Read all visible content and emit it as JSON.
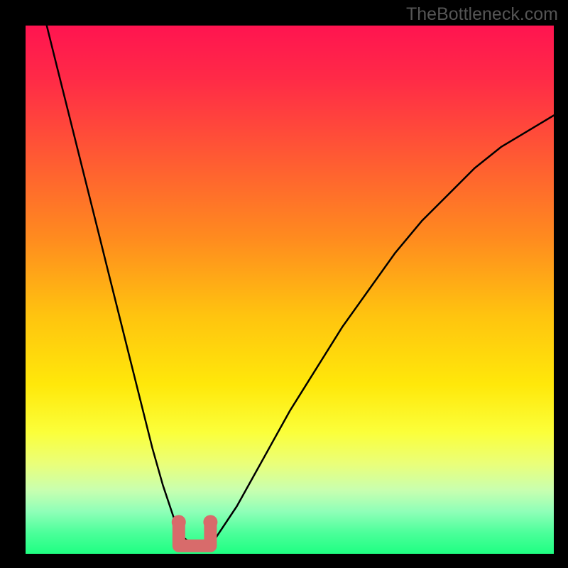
{
  "watermark": {
    "text": "TheBottleneck.com"
  },
  "colors": {
    "frame": "#000000",
    "curve": "#000000",
    "marker": "#d86b6b",
    "gradient_stops": [
      {
        "offset": 0.0,
        "color": "#ff1450"
      },
      {
        "offset": 0.1,
        "color": "#ff2a47"
      },
      {
        "offset": 0.25,
        "color": "#ff5a33"
      },
      {
        "offset": 0.4,
        "color": "#ff8a1f"
      },
      {
        "offset": 0.55,
        "color": "#ffc40f"
      },
      {
        "offset": 0.68,
        "color": "#ffe80a"
      },
      {
        "offset": 0.77,
        "color": "#fbff3a"
      },
      {
        "offset": 0.83,
        "color": "#eaff7a"
      },
      {
        "offset": 0.88,
        "color": "#c8ffb0"
      },
      {
        "offset": 0.92,
        "color": "#8fffb8"
      },
      {
        "offset": 0.96,
        "color": "#4cff9a"
      },
      {
        "offset": 1.0,
        "color": "#1fff82"
      }
    ]
  },
  "chart_data": {
    "type": "line",
    "title": "",
    "xlabel": "",
    "ylabel": "",
    "x_range": [
      0,
      100
    ],
    "y_range": [
      0,
      100
    ],
    "ylim": [
      0,
      100
    ],
    "notes": "V-shaped bottleneck curve with flat minimum region near x≈29–35; highlighted salmon markers at trough edges.",
    "series": [
      {
        "name": "bottleneck-curve",
        "x": [
          4,
          6,
          8,
          10,
          12,
          14,
          16,
          18,
          20,
          22,
          24,
          26,
          28,
          30,
          32,
          34,
          36,
          40,
          45,
          50,
          55,
          60,
          65,
          70,
          75,
          80,
          85,
          90,
          95,
          100
        ],
        "y": [
          100,
          92,
          84,
          76,
          68,
          60,
          52,
          44,
          36,
          28,
          20,
          13,
          7,
          3,
          1.5,
          1.5,
          3,
          9,
          18,
          27,
          35,
          43,
          50,
          57,
          63,
          68,
          73,
          77,
          80,
          83
        ]
      }
    ],
    "markers": [
      {
        "name": "left-edge",
        "x": 29,
        "y": 6
      },
      {
        "name": "right-edge",
        "x": 35,
        "y": 6
      }
    ],
    "trough_segment": {
      "x0": 29,
      "x1": 35,
      "y": 1.5
    }
  }
}
